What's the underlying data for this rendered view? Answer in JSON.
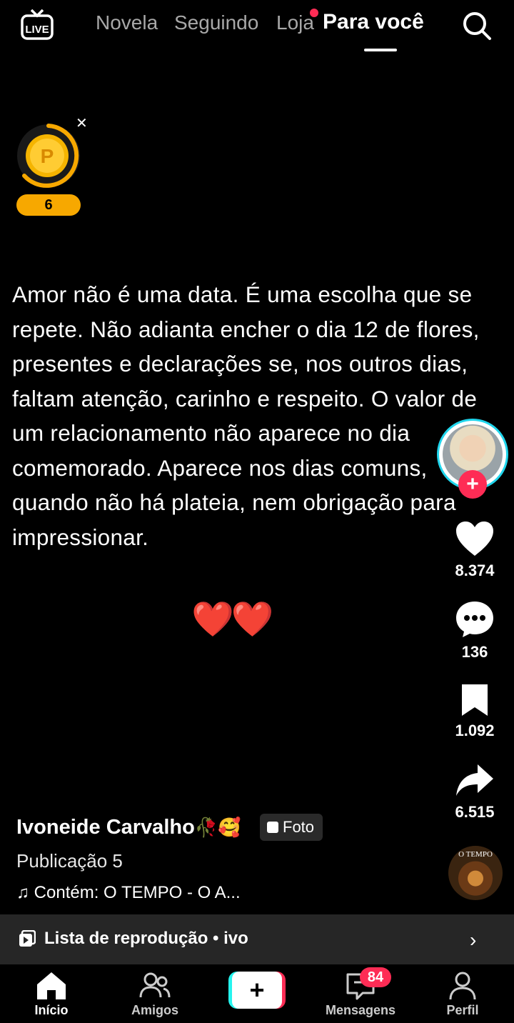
{
  "top_nav": {
    "live_label": "LIVE",
    "tabs": [
      {
        "label": "Novela"
      },
      {
        "label": "Seguindo"
      },
      {
        "label": "Loja"
      },
      {
        "label": "Para você"
      }
    ],
    "active_tab": "Para você"
  },
  "coin_widget": {
    "count": "6",
    "coin_letter": "P"
  },
  "post": {
    "text": "Amor não é uma data. É uma escolha que se repete. Não adianta encher o dia 12 de flores, presentes e declarações se, nos outros dias, faltam atenção, carinho e respeito. O valor de um relacionamento não aparece no dia comemorado. Aparece nos dias comuns, quando não há plateia, nem obrigação para impressionar.",
    "hearts": "❤️❤️"
  },
  "rail": {
    "likes": "8.374",
    "comments": "136",
    "saves": "1.092",
    "shares": "6.515",
    "follow_plus": "+",
    "disc_label": "O TEMPO"
  },
  "caption": {
    "author": "Ivoneide Carvalho",
    "author_emoji": "🥀🥰",
    "type_badge": "Foto",
    "post_label": "Publicação 5",
    "sound": "Contém: O TEMPO - O A..."
  },
  "playlist": {
    "label": "Lista de reprodução • ivo"
  },
  "tabbar": {
    "items": [
      {
        "label": "Início"
      },
      {
        "label": "Amigos"
      },
      {
        "label": ""
      },
      {
        "label": "Mensagens"
      },
      {
        "label": "Perfil"
      }
    ],
    "create_symbol": "+",
    "messages_badge": "84"
  },
  "colors": {
    "accent_red": "#fe2c55",
    "accent_cyan": "#25f4ee",
    "coin_gold": "#f7a800"
  }
}
